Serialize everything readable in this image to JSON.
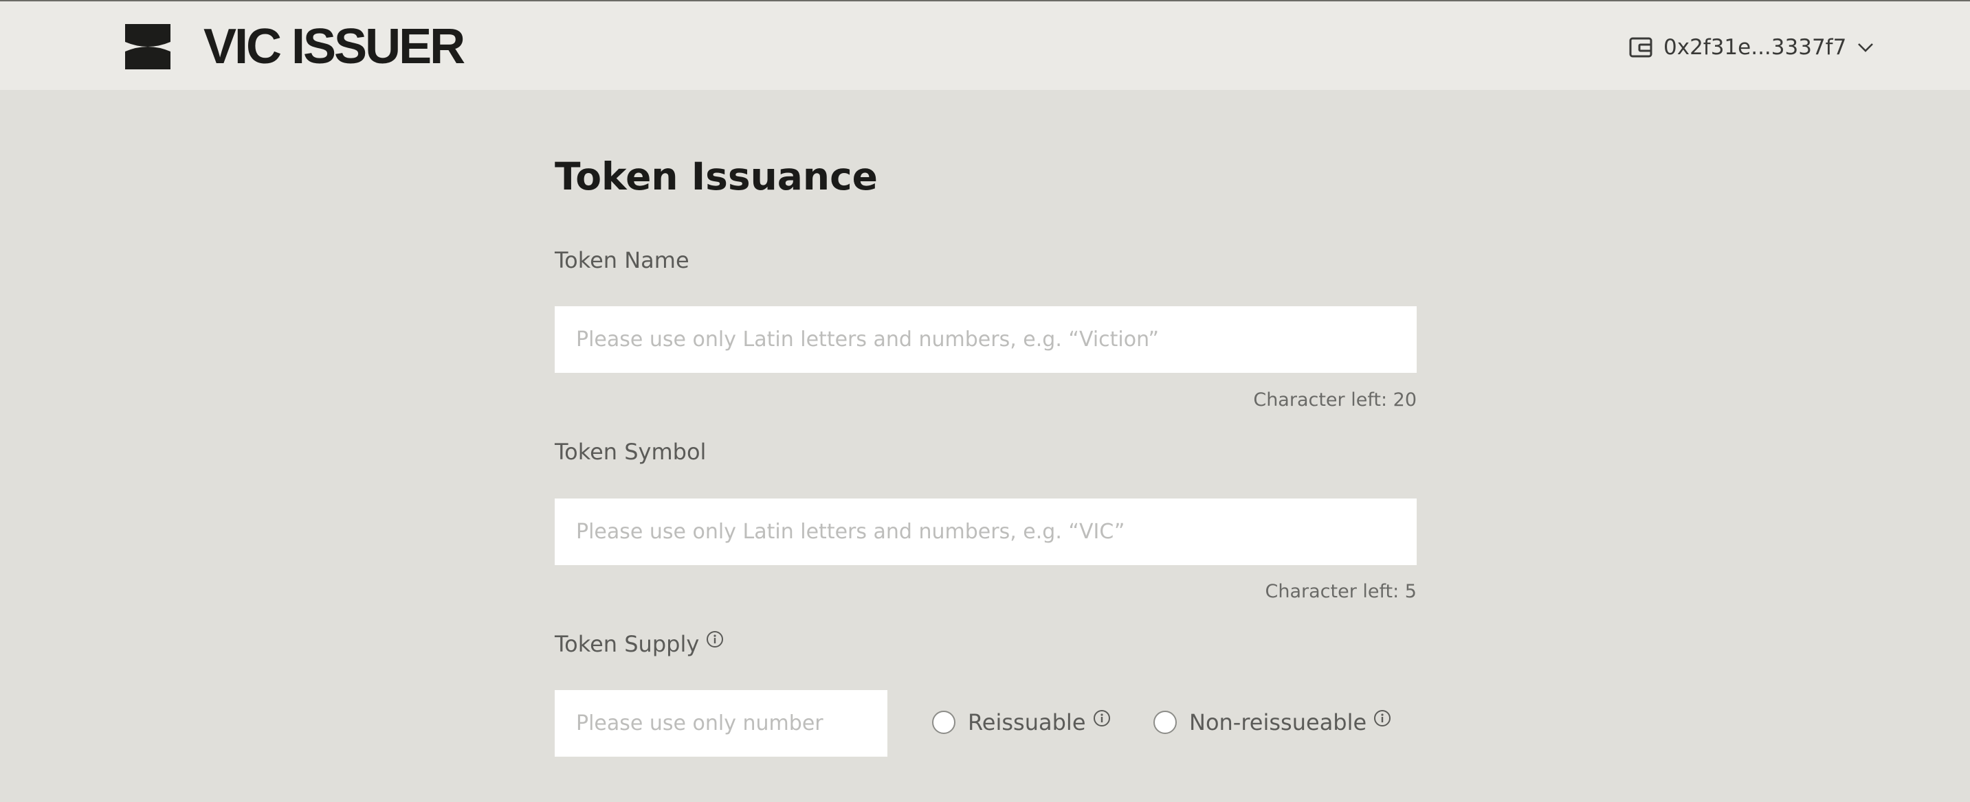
{
  "header": {
    "brand": "VIC ISSUER",
    "wallet_address": "0x2f31e...3337f7"
  },
  "form": {
    "title": "Token Issuance",
    "token_name": {
      "label": "Token Name",
      "placeholder": "Please use only Latin letters and numbers, e.g. “Viction”",
      "hint": "Character left: 20"
    },
    "token_symbol": {
      "label": "Token Symbol",
      "placeholder": "Please use only Latin letters and numbers, e.g. “VIC”",
      "hint": "Character left: 5"
    },
    "token_supply": {
      "label": "Token Supply",
      "placeholder": "Please use only number",
      "options": [
        "Reissuable",
        "Non-reissueable"
      ]
    }
  },
  "icons": {
    "logo": "logo-icon",
    "wallet": "wallet-icon",
    "chevron": "chevron-down-icon",
    "info": "info-icon"
  },
  "colors": {
    "background": "#e0dfda",
    "header": "#ebeae6",
    "text_dark": "#1b1b19"
  }
}
